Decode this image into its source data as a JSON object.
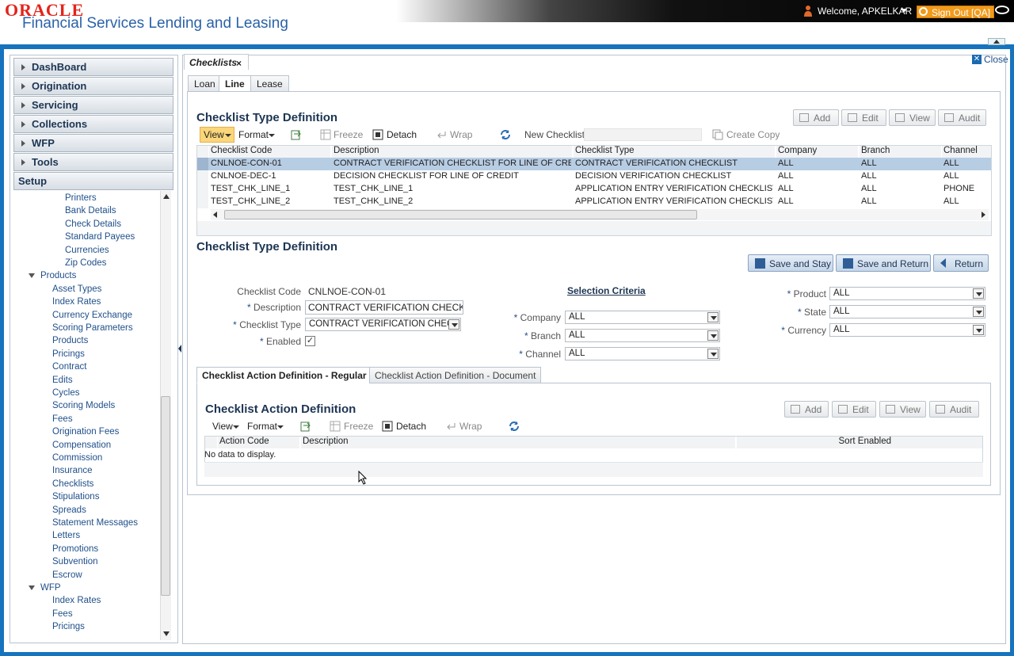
{
  "header": {
    "oracle_logo": "ORACLE",
    "product_name": "Financial Services Lending and Leasing",
    "welcome": "Welcome, APKELKAR",
    "sign_out": "Sign Out [QA]"
  },
  "sidebar": {
    "accordion": [
      "DashBoard",
      "Origination",
      "Servicing",
      "Collections",
      "WFP",
      "Tools"
    ],
    "setup_label": "Setup",
    "tree": [
      {
        "label": "Printers",
        "level": 2
      },
      {
        "label": "Bank Details",
        "level": 2
      },
      {
        "label": "Check Details",
        "level": 2
      },
      {
        "label": "Standard Payees",
        "level": 2
      },
      {
        "label": "Currencies",
        "level": 2
      },
      {
        "label": "Zip Codes",
        "level": 2
      },
      {
        "label": "Products",
        "level": 0
      },
      {
        "label": "Asset Types",
        "level": 1
      },
      {
        "label": "Index Rates",
        "level": 1
      },
      {
        "label": "Currency Exchange",
        "level": 1
      },
      {
        "label": "Scoring Parameters",
        "level": 1
      },
      {
        "label": "Products",
        "level": 1
      },
      {
        "label": "Pricings",
        "level": 1
      },
      {
        "label": "Contract",
        "level": 1
      },
      {
        "label": "Edits",
        "level": 1
      },
      {
        "label": "Cycles",
        "level": 1
      },
      {
        "label": "Scoring Models",
        "level": 1
      },
      {
        "label": "Fees",
        "level": 1
      },
      {
        "label": "Origination Fees",
        "level": 1
      },
      {
        "label": "Compensation",
        "level": 1
      },
      {
        "label": "Commission",
        "level": 1
      },
      {
        "label": "Insurance",
        "level": 1
      },
      {
        "label": "Checklists",
        "level": 1
      },
      {
        "label": "Stipulations",
        "level": 1
      },
      {
        "label": "Spreads",
        "level": 1
      },
      {
        "label": "Statement Messages",
        "level": 1
      },
      {
        "label": "Letters",
        "level": 1
      },
      {
        "label": "Promotions",
        "level": 1
      },
      {
        "label": "Subvention",
        "level": 1
      },
      {
        "label": "Escrow",
        "level": 1
      },
      {
        "label": "WFP",
        "level": 0
      },
      {
        "label": "Index Rates",
        "level": 1
      },
      {
        "label": "Fees",
        "level": 1
      },
      {
        "label": "Pricings",
        "level": 1
      }
    ]
  },
  "main": {
    "tab_label": "Checklists",
    "close_label": "Close",
    "subtabs": [
      "Loan",
      "Line",
      "Lease"
    ],
    "section1_title": "Checklist Type Definition",
    "toolbar1": {
      "add": "Add",
      "edit": "Edit",
      "view_btn": "View",
      "audit": "Audit",
      "view": "View",
      "format": "Format",
      "freeze": "Freeze",
      "detach": "Detach",
      "wrap": "Wrap",
      "new_checklist": "New Checklist",
      "create_copy": "Create Copy"
    },
    "grid1": {
      "columns": [
        "Checklist Code",
        "Description",
        "Checklist Type",
        "Company",
        "Branch",
        "Channel"
      ],
      "rows": [
        [
          "CNLNOE-CON-01",
          "CONTRACT VERIFICATION CHECKLIST FOR LINE OF CREDIT",
          "CONTRACT VERIFICATION CHECKLIST",
          "ALL",
          "ALL",
          "ALL"
        ],
        [
          "CNLNOE-DEC-1",
          "DECISION CHECKLIST FOR LINE OF CREDIT",
          "DECISION VERIFICATION CHECKLIST",
          "ALL",
          "ALL",
          "ALL"
        ],
        [
          "TEST_CHK_LINE_1",
          "TEST_CHK_LINE_1",
          "APPLICATION ENTRY VERIFICATION CHECKLIST",
          "ALL",
          "ALL",
          "PHONE"
        ],
        [
          "TEST_CHK_LINE_2",
          "TEST_CHK_LINE_2",
          "APPLICATION ENTRY VERIFICATION CHECKLIST",
          "ALL",
          "ALL",
          "ALL"
        ]
      ]
    },
    "section2_title": "Checklist Type Definition",
    "buttons": {
      "save_stay": "Save and Stay",
      "save_return": "Save and Return",
      "return": "Return"
    },
    "form": {
      "code_label": "Checklist Code",
      "code_value": "CNLNOE-CON-01",
      "desc_label": "Description",
      "desc_value": "CONTRACT VERIFICATION CHECKLIST F",
      "type_label": "Checklist Type",
      "type_value": "CONTRACT VERIFICATION CHECKLI",
      "enabled_label": "Enabled",
      "enabled_check": "✓",
      "selection_criteria": "Selection Criteria",
      "company_label": "Company",
      "company_value": "ALL",
      "branch_label": "Branch",
      "branch_value": "ALL",
      "channel_label": "Channel",
      "channel_value": "ALL",
      "product_label": "Product",
      "product_value": "ALL",
      "state_label": "State",
      "state_value": "ALL",
      "currency_label": "Currency",
      "currency_value": "ALL",
      "req": "*"
    },
    "action_tabs": [
      "Checklist Action Definition - Regular",
      "Checklist Action Definition - Document"
    ],
    "section3_title": "Checklist Action Definition",
    "grid2": {
      "columns": [
        "Action Code",
        "Description",
        "Sort Enabled"
      ],
      "empty": "No data to display."
    }
  },
  "colors": {
    "frame_blue": "#1673bd",
    "accent_orange": "#f19a1c",
    "title_navy": "#1d3553",
    "selected_row": "#b7cde4"
  }
}
